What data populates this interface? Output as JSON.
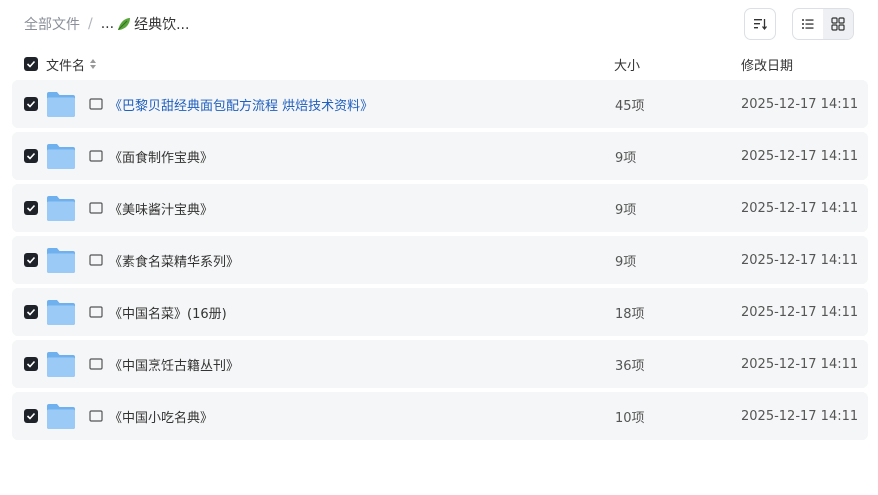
{
  "breadcrumb": {
    "root": "全部文件",
    "separator": "/",
    "current": "...",
    "current_suffix": "经典饮..."
  },
  "toolbar": {
    "sort_icon": "sort-icon",
    "list_view_icon": "list-view-icon",
    "grid_view_icon": "grid-view-icon"
  },
  "table": {
    "headers": {
      "name": "文件名",
      "size": "大小",
      "modified": "修改日期"
    },
    "rows": [
      {
        "name": "《巴黎贝甜经典面包配方流程 烘焙技术资料》",
        "size": "45项",
        "modified": "2025-12-17 14:11"
      },
      {
        "name": "《面食制作宝典》",
        "size": "9项",
        "modified": "2025-12-17 14:11"
      },
      {
        "name": "《美味酱汁宝典》",
        "size": "9项",
        "modified": "2025-12-17 14:11"
      },
      {
        "name": "《素食名菜精华系列》",
        "size": "9项",
        "modified": "2025-12-17 14:11"
      },
      {
        "name": "《中国名菜》(16册)",
        "size": "18项",
        "modified": "2025-12-17 14:11"
      },
      {
        "name": "《中国烹饪古籍丛刊》",
        "size": "36项",
        "modified": "2025-12-17 14:11"
      },
      {
        "name": "《中国小吃名典》",
        "size": "10项",
        "modified": "2025-12-17 14:11"
      }
    ]
  },
  "colors": {
    "row_bg": "#f5f6f7",
    "checkbox": "#1f2329",
    "link": "#1f5fbf",
    "folder": "#7fb8f0"
  }
}
